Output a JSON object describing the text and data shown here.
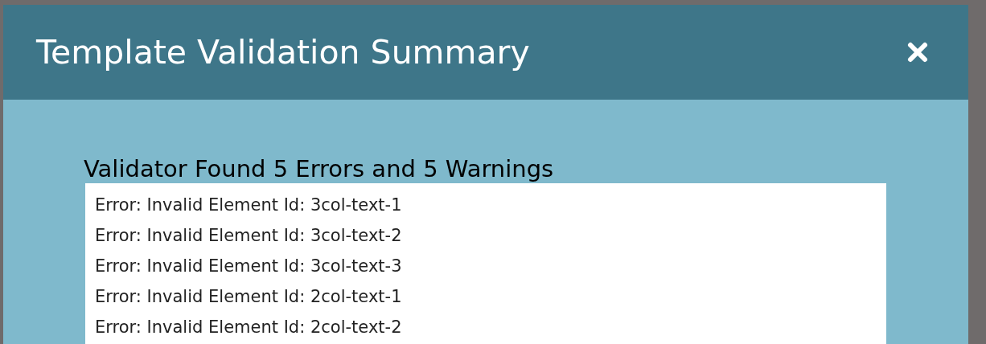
{
  "dialog": {
    "title": "Template Validation Summary"
  },
  "summary": {
    "heading": "Validator Found 5 Errors and 5 Warnings",
    "messages": [
      "Error: Invalid Element Id: 3col-text-1",
      "Error: Invalid Element Id: 3col-text-2",
      "Error: Invalid Element Id: 3col-text-3",
      "Error: Invalid Element Id: 2col-text-1",
      "Error: Invalid Element Id: 2col-text-2"
    ]
  }
}
